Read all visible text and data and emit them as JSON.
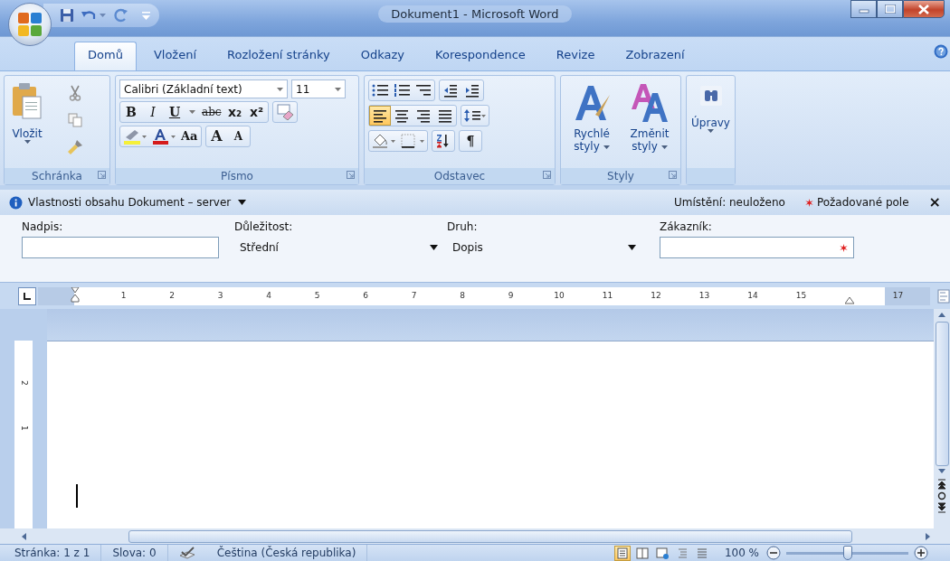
{
  "window": {
    "title": "Dokument1 - Microsoft Word"
  },
  "tabs": [
    {
      "label": "Domů",
      "selected": true
    },
    {
      "label": "Vložení",
      "selected": false
    },
    {
      "label": "Rozložení stránky",
      "selected": false
    },
    {
      "label": "Odkazy",
      "selected": false
    },
    {
      "label": "Korespondence",
      "selected": false
    },
    {
      "label": "Revize",
      "selected": false
    },
    {
      "label": "Zobrazení",
      "selected": false
    }
  ],
  "ribbon": {
    "clipboard": {
      "paste_label": "Vložit",
      "group_label": "Schránka"
    },
    "font": {
      "font_name": "Calibri (Základní text)",
      "font_size": "11",
      "format_buttons": [
        {
          "kind": "bold",
          "label": "B"
        },
        {
          "kind": "italic",
          "label": "I"
        },
        {
          "kind": "underline",
          "label": "U"
        },
        {
          "kind": "strike",
          "label": "abc"
        },
        {
          "kind": "sub",
          "label": "x₂"
        },
        {
          "kind": "sup",
          "label": "x²"
        }
      ],
      "case_button": "Aa",
      "grow_button": "A",
      "shrink_button": "A",
      "group_label": "Písmo"
    },
    "paragraph": {
      "alignments": [
        {
          "kind": "left",
          "selected": true
        },
        {
          "kind": "center",
          "selected": false
        },
        {
          "kind": "right",
          "selected": false
        },
        {
          "kind": "justify",
          "selected": false
        }
      ],
      "pilcrow": "¶",
      "group_label": "Odstavec"
    },
    "styles": {
      "buttons": [
        {
          "line1": "Rychlé",
          "line2": "styly"
        },
        {
          "line1": "Změnit",
          "line2": "styly"
        }
      ],
      "group_label": "Styly"
    },
    "editing": {
      "label": "Úpravy"
    }
  },
  "document_panel": {
    "title": "Vlastnosti obsahu Dokument – server",
    "location": "Umístění: neuloženo",
    "required_note": "Požadované pole",
    "close": "×",
    "fields": [
      {
        "label": "Nadpis:",
        "kind": "text",
        "required": false
      },
      {
        "label": "Důležitost:",
        "kind": "dropdown",
        "value": "Střední",
        "required": false
      },
      {
        "label": "Druh:",
        "kind": "dropdown",
        "value": "Dopis",
        "required": false
      },
      {
        "label": "Zákazník:",
        "kind": "text",
        "required": true
      }
    ]
  },
  "ruler": {
    "numbers": [
      "1",
      "2",
      "3",
      "4",
      "5",
      "6",
      "7",
      "8",
      "9",
      "10",
      "11",
      "12",
      "13",
      "14",
      "15"
    ],
    "end_number": "17",
    "vertical_numbers": [
      "2",
      "1"
    ]
  },
  "status_bar": {
    "page": "Stránka: 1 z 1",
    "words": "Slova: 0",
    "language": "Čeština (Česká republika)",
    "views": [
      {
        "selected": true
      },
      {
        "selected": false
      },
      {
        "selected": false
      },
      {
        "selected": false
      },
      {
        "selected": false
      }
    ],
    "zoom": "100 %",
    "zoom_slider": {
      "level": 0.5
    }
  }
}
